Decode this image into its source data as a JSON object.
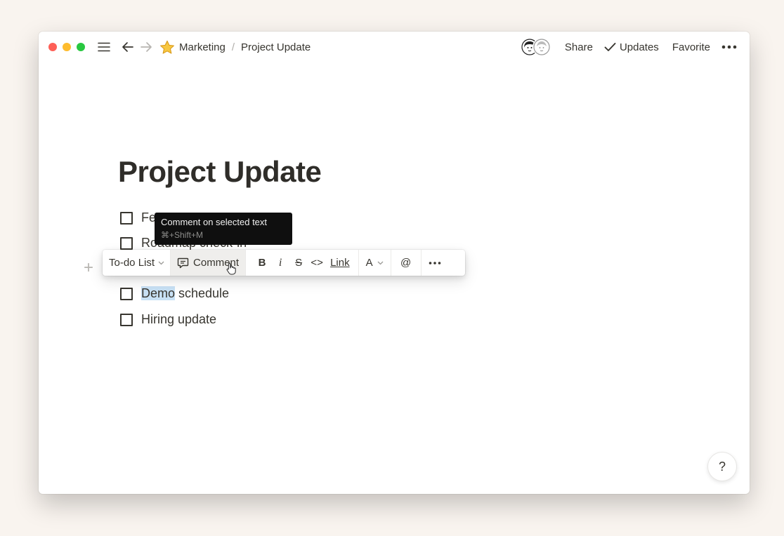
{
  "breadcrumb": {
    "workspace": "Marketing",
    "separator": "/",
    "page": "Project Update"
  },
  "header": {
    "share": "Share",
    "updates": "Updates",
    "favorite": "Favorite"
  },
  "page": {
    "title": "Project Update",
    "todos": [
      {
        "text": "Fe",
        "checked": false
      },
      {
        "text": "Roadmap check-in",
        "checked": false
      },
      {
        "text": "Demo schedule",
        "highlighted": "Demo",
        "rest": " schedule",
        "checked": false
      },
      {
        "text": "Hiring update",
        "checked": false
      }
    ]
  },
  "toolbar": {
    "block_type": "To-do List",
    "comment": "Comment",
    "bold": "B",
    "italic": "i",
    "strike": "S",
    "code": "<>",
    "link": "Link",
    "color": "A",
    "mention": "@"
  },
  "tooltip": {
    "title": "Comment on selected text",
    "shortcut": "⌘+Shift+M"
  },
  "help": {
    "label": "?"
  },
  "icons": {
    "hamburger": "menu-icon",
    "back": "arrow-left-icon",
    "forward": "arrow-right-icon",
    "page_icon": "star-icon",
    "updates": "checkmark-icon",
    "more": "ellipsis-icon"
  },
  "colors": {
    "text": "#37352f",
    "highlight": "#c8e1f5",
    "tooltip_bg": "#0f0f0f",
    "traffic_close": "#fe5f57",
    "traffic_minimize": "#febc2e",
    "traffic_maximize": "#28c840"
  }
}
